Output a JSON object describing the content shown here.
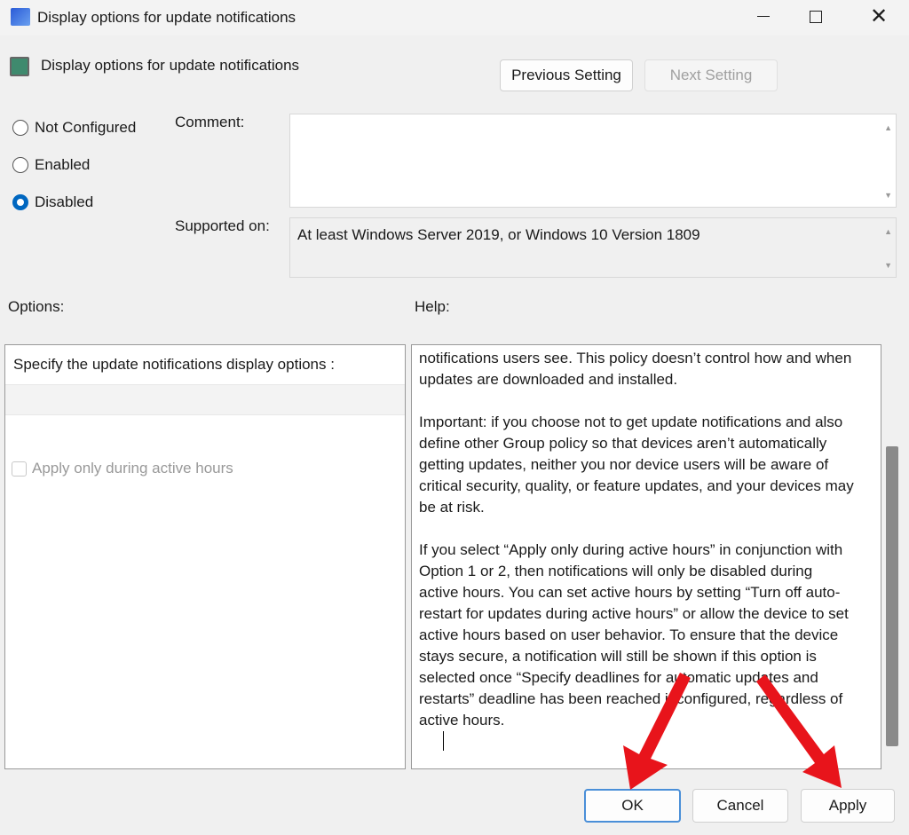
{
  "window": {
    "title": "Display options for update notifications"
  },
  "header": {
    "policy_name": "Display options for update notifications",
    "previous": "Previous Setting",
    "next": "Next Setting"
  },
  "state": {
    "options": [
      "Not Configured",
      "Enabled",
      "Disabled"
    ],
    "selected": "Disabled"
  },
  "comment": {
    "label": "Comment:",
    "value": ""
  },
  "supported": {
    "label": "Supported on:",
    "value": "At least Windows Server 2019, or Windows 10 Version 1809"
  },
  "options": {
    "label": "Options:",
    "heading": "Specify the update notifications display options :",
    "checkbox": "Apply only during active hours",
    "checked": false
  },
  "help": {
    "label": "Help:",
    "lines": [
      "notifications users see. This policy doesn’t control how and when",
      "updates are downloaded and installed.",
      "",
      "Important: if you choose not to get update notifications and also",
      "define other Group policy so that devices aren’t automatically",
      "getting updates, neither you nor device users will be aware of",
      "critical security, quality, or feature updates, and your devices may",
      "be at risk.",
      "",
      "If you select “Apply only during active hours” in conjunction with",
      "Option 1 or 2, then notifications will only be disabled during",
      "active hours. You can set active hours by setting “Turn off auto-",
      "restart for updates during active hours” or allow the device to set",
      "active hours based on user behavior. To ensure that the device",
      "stays secure, a notification will still be shown if this option is",
      "selected once “Specify deadlines for automatic updates and",
      "restarts” deadline has been reached if configured, regardless of",
      "active hours."
    ]
  },
  "footer": {
    "ok": "OK",
    "cancel": "Cancel",
    "apply": "Apply"
  },
  "colors": {
    "accent": "#0067c0",
    "arrow": "#e8141b"
  }
}
